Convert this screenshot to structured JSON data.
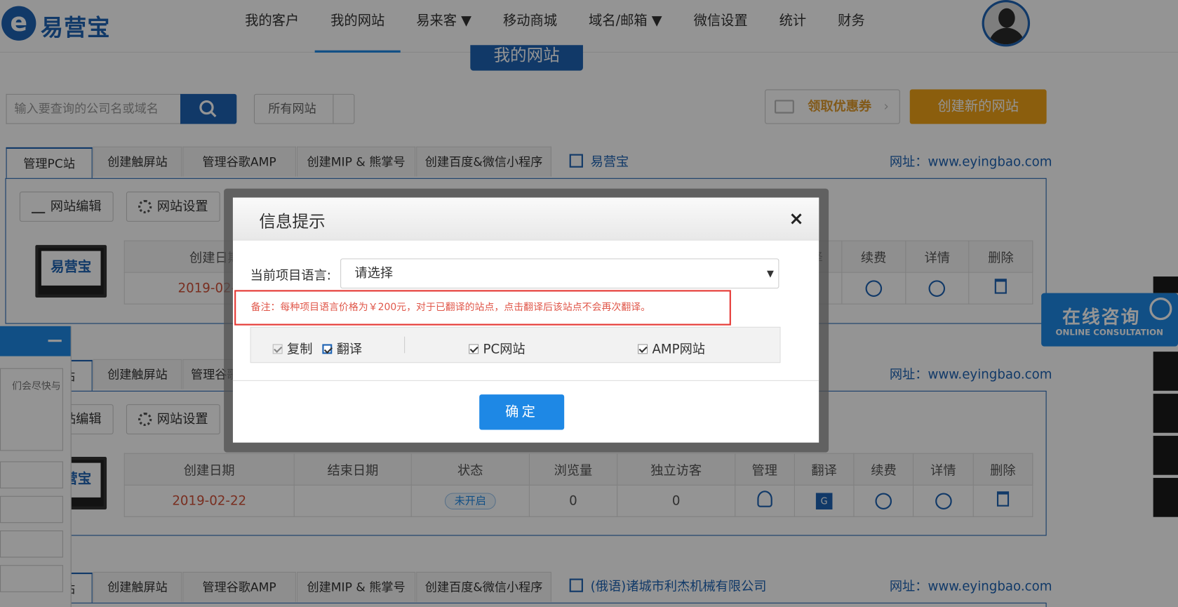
{
  "header": {
    "logo_text": "易营宝",
    "nav": [
      "我的客户",
      "我的网站",
      "易来客 ▼",
      "移动商城",
      "域名/邮箱 ▼",
      "微信设置",
      "统计",
      "财务"
    ],
    "active_index": 1
  },
  "page": {
    "title": "我的网站",
    "search_placeholder": "输入要查询的公司名或域名",
    "filter_value": "所有网站",
    "coupon_label": "领取优惠券",
    "create_label": "创建新的网站"
  },
  "tabs": [
    "管理PC站",
    "创建触屏站",
    "管理谷歌AMP",
    "创建MIP & 熊掌号",
    "创建百度&微信小程序"
  ],
  "sites": [
    {
      "name": "易营宝",
      "url": "网址：www.eyingbao.com"
    },
    {
      "name": "",
      "url": "网址：www.eyingbao.com"
    },
    {
      "name": "(俄语)诸城市利杰机械有限公司",
      "url": "网址：www.eyingbao.com"
    }
  ],
  "toolbar": {
    "edit": "网站编辑",
    "settings": "网站设置"
  },
  "table": {
    "headers": [
      "创建日期",
      "结束日期",
      "状态",
      "浏览量",
      "独立访客",
      "管理",
      "翻译",
      "续费",
      "详情",
      "删除"
    ],
    "row": {
      "create_date": "2019-02-22",
      "status": "未开启",
      "views": "0",
      "visitors": "0"
    }
  },
  "thumb_text": "易营宝",
  "chat": {
    "text": "们会尽快与"
  },
  "consult": {
    "cn": "在线咨询",
    "en": "ONLINE CONSULTATION"
  },
  "modal": {
    "title": "信息提示",
    "close": "×",
    "lang_label": "当前项目语言:",
    "lang_value": "请选择",
    "note": "备注：每种项目语言价格为￥200元，对于已翻译的站点，点击翻译后该站点不会再次翻译。",
    "options": {
      "copy": "复制",
      "translate": "翻译",
      "pc": "PC网站",
      "amp": "AMP网站"
    },
    "confirm": "确定"
  }
}
